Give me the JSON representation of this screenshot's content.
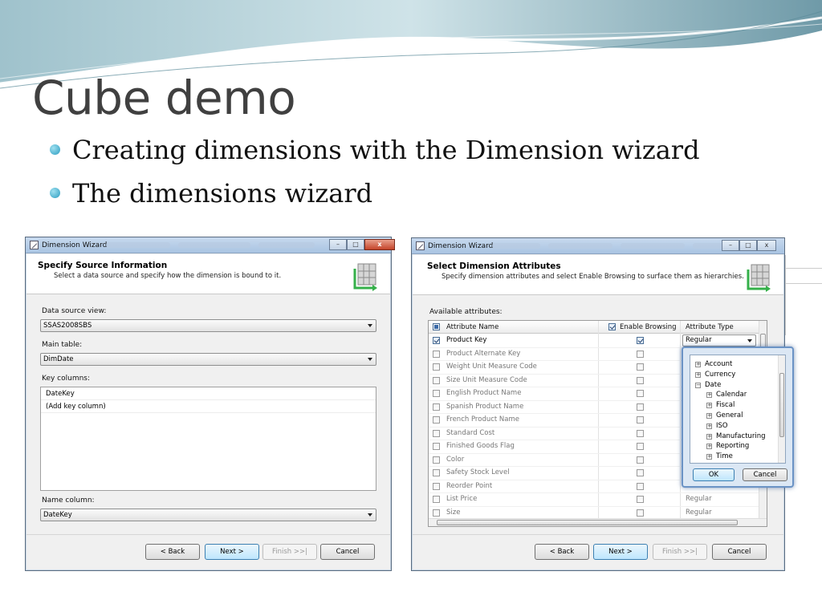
{
  "slide": {
    "title": "Cube demo",
    "bullets": [
      "Creating dimensions with the Dimension wizard",
      "The dimensions wizard"
    ]
  },
  "wizard_left": {
    "window_title": "Dimension Wizard",
    "header_title": "Specify Source Information",
    "header_subtitle": "Select a data source and specify how the dimension is bound to it.",
    "data_source_label": "Data source view:",
    "data_source_value": "SSAS2008SBS",
    "main_table_label": "Main table:",
    "main_table_value": "DimDate",
    "key_columns_label": "Key columns:",
    "key_columns": [
      "DateKey",
      "(Add key column)"
    ],
    "name_column_label": "Name column:",
    "name_column_value": "DateKey",
    "buttons": {
      "back": "< Back",
      "next": "Next >",
      "finish": "Finish >>|",
      "cancel": "Cancel"
    }
  },
  "wizard_right": {
    "window_title": "Dimension Wizard",
    "header_title": "Select Dimension Attributes",
    "header_subtitle": "Specify dimension attributes and select Enable Browsing to surface them as hierarchies.",
    "available_label": "Available attributes:",
    "columns": {
      "name": "Attribute Name",
      "browse": "Enable Browsing",
      "type": "Attribute Type"
    },
    "attributes": [
      {
        "name": "Product Key",
        "selected": true,
        "browse": true,
        "type": "Regular"
      },
      {
        "name": "Product Alternate Key",
        "selected": false,
        "browse": false,
        "type": ""
      },
      {
        "name": "Weight Unit Measure Code",
        "selected": false,
        "browse": false,
        "type": ""
      },
      {
        "name": "Size Unit Measure Code",
        "selected": false,
        "browse": false,
        "type": ""
      },
      {
        "name": "English Product Name",
        "selected": false,
        "browse": false,
        "type": ""
      },
      {
        "name": "Spanish Product Name",
        "selected": false,
        "browse": false,
        "type": ""
      },
      {
        "name": "French Product Name",
        "selected": false,
        "browse": false,
        "type": ""
      },
      {
        "name": "Standard Cost",
        "selected": false,
        "browse": false,
        "type": ""
      },
      {
        "name": "Finished Goods Flag",
        "selected": false,
        "browse": false,
        "type": ""
      },
      {
        "name": "Color",
        "selected": false,
        "browse": false,
        "type": ""
      },
      {
        "name": "Safety Stock Level",
        "selected": false,
        "browse": false,
        "type": ""
      },
      {
        "name": "Reorder Point",
        "selected": false,
        "browse": false,
        "type": ""
      },
      {
        "name": "List Price",
        "selected": false,
        "browse": false,
        "type": "Regular"
      },
      {
        "name": "Size",
        "selected": false,
        "browse": false,
        "type": "Regular"
      }
    ],
    "type_popup": {
      "items": [
        "Account",
        "Currency",
        "Date",
        "Calendar",
        "Fiscal",
        "General",
        "ISO",
        "Manufacturing",
        "Reporting",
        "Time"
      ],
      "ok": "OK",
      "cancel": "Cancel"
    },
    "buttons": {
      "back": "< Back",
      "next": "Next >",
      "finish": "Finish >>|",
      "cancel": "Cancel"
    }
  }
}
